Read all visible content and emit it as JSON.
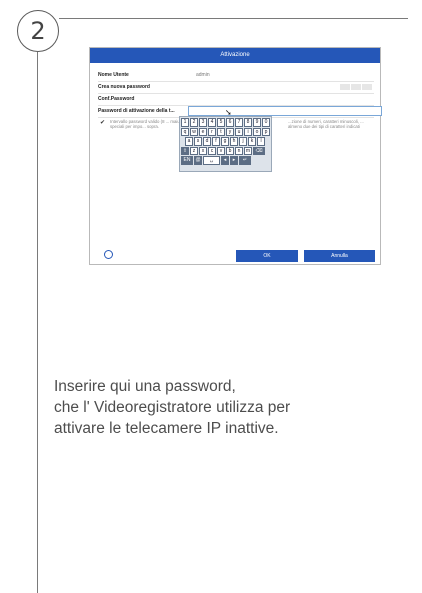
{
  "step": "2",
  "window": {
    "title": "Attivazione",
    "fields": [
      {
        "label": "Nome Utente",
        "value": "admin"
      },
      {
        "label": "Crea nuova password",
        "value": ""
      },
      {
        "label": "Conf.Password",
        "value": ""
      },
      {
        "label": "Password di attivazione della t...",
        "value": ""
      }
    ],
    "hint_left": "Intervallo password valido (8 ... maiuscoli o speciali per impo... sopra.",
    "hint_right": "...zione di numeri, caratteri minuscoli, ... almeno due dei tipi di caratteri indicati",
    "keyboard": {
      "rows": [
        [
          "1",
          "2",
          "3",
          "4",
          "5",
          "6",
          "7",
          "8",
          "9",
          "0"
        ],
        [
          "q",
          "w",
          "e",
          "r",
          "t",
          "y",
          "u",
          "i",
          "o",
          "p"
        ],
        [
          "a",
          "s",
          "d",
          "f",
          "g",
          "h",
          "j",
          "k",
          "l"
        ],
        [
          "⇧",
          "z",
          "x",
          "c",
          "v",
          "b",
          "n",
          "m",
          "⌫"
        ],
        [
          "EN",
          "@",
          "␣",
          "◂",
          "▸",
          "↵"
        ]
      ]
    },
    "ok_label": "OK",
    "cancel_label": "Annulla"
  },
  "description": [
    "Inserire qui una password,",
    "che l' Videoregistratore utilizza per",
    "attivare le telecamere IP inattive."
  ]
}
